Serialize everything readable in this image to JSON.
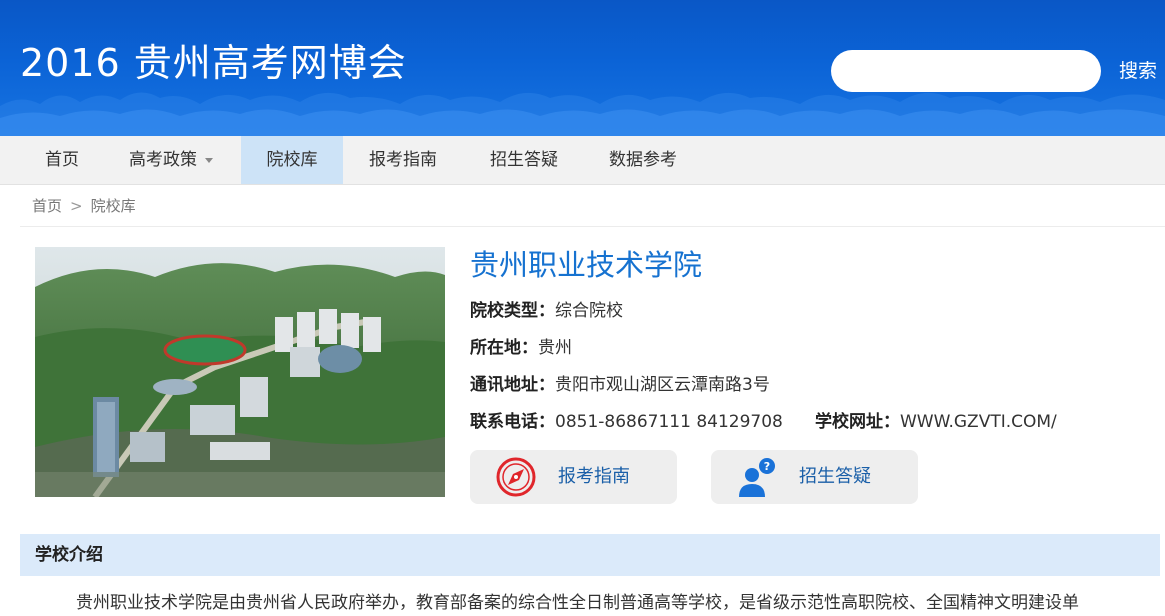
{
  "header": {
    "site_title": "2016 贵州高考网博会",
    "search": {
      "placeholder": "",
      "value": "",
      "button_label": "搜索"
    }
  },
  "nav": {
    "items": [
      {
        "label": "首页"
      },
      {
        "label": "高考政策"
      },
      {
        "label": "院校库"
      },
      {
        "label": "报考指南"
      },
      {
        "label": "招生答疑"
      },
      {
        "label": "数据参考"
      }
    ],
    "active": "院校库"
  },
  "breadcrumb": {
    "home": "首页",
    "separator": ">",
    "current": "院校库"
  },
  "school": {
    "name": "贵州职业技术学院",
    "type_label": "院校类型：",
    "type_value": "综合院校",
    "location_label": "所在地：",
    "location_value": "贵州",
    "address_label": "通讯地址：",
    "address_value": "贵阳市观山湖区云潭南路3号",
    "phone_label": "联系电话：",
    "phone_value": "0851-86867111 84129708",
    "website_label": "学校网址：",
    "website_value": "WWW.GZVTI.COM/"
  },
  "actions": {
    "guide_label": "报考指南",
    "qa_label": "招生答疑"
  },
  "intro": {
    "heading": "学校介绍",
    "text": "贵州职业技术学院是由贵州省人民政府举办，教育部备案的综合性全日制普通高等学校，是省级示范性高职院校、全国精神文明建设单"
  },
  "colors": {
    "banner_blue": "#0b63d6",
    "title_blue": "#1672d0",
    "nav_active": "#cde3f7",
    "section_bg": "#dbeafa",
    "icon_red": "#e0262b",
    "icon_blue": "#1a72d8"
  },
  "icons": [
    "compass-icon",
    "user-question-icon"
  ]
}
